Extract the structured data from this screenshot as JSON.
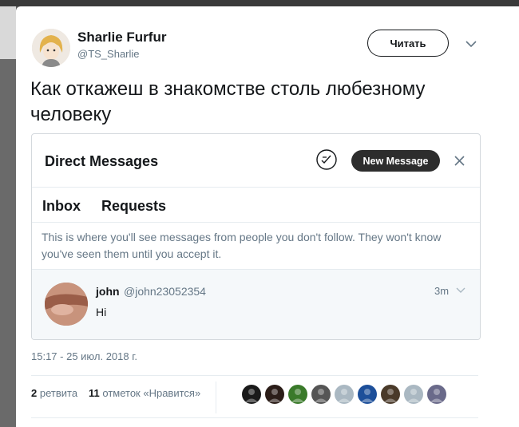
{
  "tweet": {
    "author_name": "Sharlie Furfur",
    "author_handle": "@TS_Sharlie",
    "follow_label": "Читать",
    "text": "Как откажеш в знакомстве столь любезному человеку",
    "timestamp": "15:17 - 25 июл. 2018 г."
  },
  "screenshot": {
    "title": "Direct Messages",
    "new_message_label": "New Message",
    "tabs": [
      {
        "label": "Inbox"
      },
      {
        "label": "Requests"
      }
    ],
    "info": "This is where you'll see messages from people you don't follow. They won't know you've seen them until you accept it.",
    "conversation": {
      "name": "john",
      "handle": "@john23052354",
      "time": "3m",
      "preview": "Hi"
    }
  },
  "stats": {
    "retweets_count": "2",
    "retweets_label": "ретвита",
    "likes_count": "11",
    "likes_label": "отметок «Нравится»"
  },
  "likers": [
    {
      "name": "liker-1",
      "color": "#1a1a1a"
    },
    {
      "name": "liker-2",
      "color": "#2b1d18"
    },
    {
      "name": "liker-3",
      "color": "#3a7a2a"
    },
    {
      "name": "liker-4",
      "color": "#555555"
    },
    {
      "name": "liker-5",
      "color": "#aab8c2"
    },
    {
      "name": "liker-6",
      "color": "#1d4f9a"
    },
    {
      "name": "liker-7",
      "color": "#4a3a2a"
    },
    {
      "name": "liker-8",
      "color": "#aab8c2"
    },
    {
      "name": "liker-9",
      "color": "#6a6a8a"
    }
  ]
}
